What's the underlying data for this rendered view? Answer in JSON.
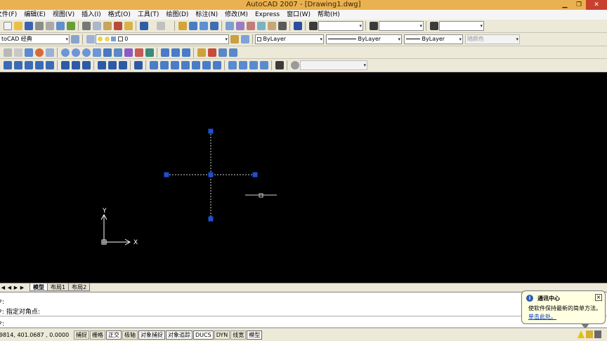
{
  "window": {
    "title": "AutoCAD 2007 - [Drawing1.dwg]",
    "minimize_icon": "minimize-icon",
    "maximize_icon": "maximize-icon",
    "close_icon": "close-icon"
  },
  "menubar": {
    "items": [
      "文件(F)",
      "编辑(E)",
      "视图(V)",
      "插入(I)",
      "格式(O)",
      "工具(T)",
      "绘图(D)",
      "标注(N)",
      "修改(M)",
      "Express",
      "窗口(W)",
      "帮助(H)"
    ]
  },
  "toolbar2": {
    "workspace": "toCAD 经典",
    "layer_value": "0",
    "color_combo": "ByLayer",
    "linetype_combo": "ByLayer",
    "lineweight_combo": "ByLayer",
    "plotstyle_combo": "随颜色"
  },
  "canvas": {
    "background": "#000000",
    "grip_color": "#1f4fd0",
    "ucs": {
      "x_label": "X",
      "y_label": "Y"
    }
  },
  "layout_tabs": [
    "模型",
    "布局1",
    "布局2"
  ],
  "command": {
    "line1": "令:",
    "line2": "令: 指定对角点:",
    "line3": "令:"
  },
  "status": {
    "coordinates": "9814, 401.0687 , 0.0000",
    "buttons": [
      "捕捉",
      "栅格",
      "正交",
      "极轴",
      "对象捕捉",
      "对象追踪",
      "DUCS",
      "DYN",
      "线宽",
      "模型"
    ],
    "on_buttons": [
      "正交",
      "对象捕捉",
      "对象追踪",
      "DUCS",
      "模型"
    ]
  },
  "balloon": {
    "title": "通讯中心",
    "message": "使软件保持最新的简单方法。",
    "link": "单击此处。"
  }
}
